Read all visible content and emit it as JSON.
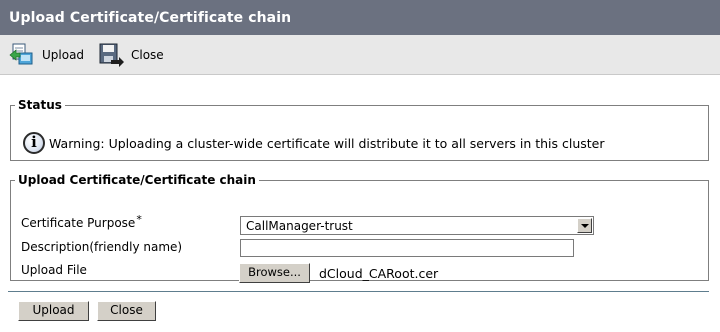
{
  "window": {
    "title": "Upload Certificate/Certificate chain"
  },
  "toolbar": {
    "upload": {
      "label": "Upload",
      "icon": "upload-icon"
    },
    "close": {
      "label": "Close",
      "icon": "save-close-icon"
    }
  },
  "status": {
    "legend": "Status",
    "icon": "info-icon",
    "message": "Warning: Uploading a cluster-wide certificate will distribute it to all servers in this cluster"
  },
  "upload_group": {
    "legend": "Upload Certificate/Certificate chain",
    "purpose": {
      "label": "Certificate Purpose",
      "required_marker": "*",
      "value": "CallManager-trust"
    },
    "description": {
      "label": "Description(friendly name)",
      "value": ""
    },
    "file": {
      "label": "Upload File",
      "browse_label": "Browse...",
      "filename": "dCloud_CARoot.cer"
    }
  },
  "footer": {
    "upload_label": "Upload",
    "close_label": "Close"
  },
  "colors": {
    "titlebar": "#6b7180",
    "toolbar": "#e8e8e8",
    "button_face": "#d4d0c8"
  }
}
